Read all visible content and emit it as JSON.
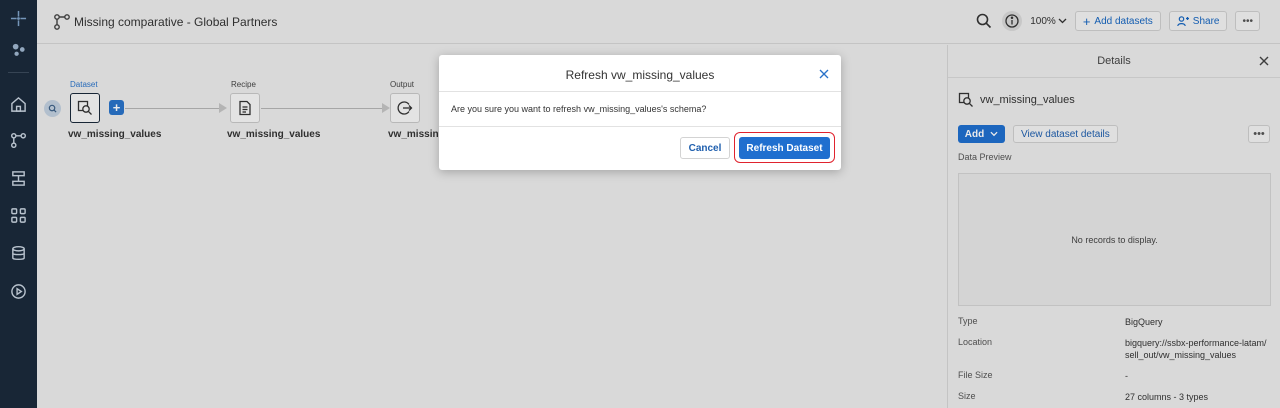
{
  "header": {
    "title": "Missing comparative - Global Partners",
    "zoom": "100%",
    "add_datasets_label": "Add datasets",
    "share_label": "Share"
  },
  "flow": {
    "nodes": [
      {
        "type_label": "Dataset",
        "name": "vw_missing_values",
        "icon": "dataset-search-icon"
      },
      {
        "type_label": "Recipe",
        "name": "vw_missing_values",
        "icon": "recipe-document-icon"
      },
      {
        "type_label": "Output",
        "name": "vw_missing_",
        "icon": "output-arrow-icon"
      }
    ]
  },
  "details": {
    "header": "Details",
    "dataset_name": "vw_missing_values",
    "add_label": "Add",
    "view_details_label": "View dataset details",
    "data_preview_label": "Data Preview",
    "empty_message": "No records to display.",
    "rows": [
      {
        "key": "Type",
        "value": "BigQuery"
      },
      {
        "key": "Location",
        "value": "bigquery://ssbx-performance-latam/sell_out/vw_missing_values"
      },
      {
        "key": "File Size",
        "value": "-"
      },
      {
        "key": "Size",
        "value": "27 columns - 3 types"
      }
    ]
  },
  "modal": {
    "title": "Refresh vw_missing_values",
    "message": "Are you sure you want to refresh vw_missing_values's schema?",
    "cancel_label": "Cancel",
    "confirm_label": "Refresh Dataset"
  },
  "colors": {
    "rail": "#1b2a3b",
    "primary": "#1f6fcf",
    "highlight": "#e0232e"
  }
}
